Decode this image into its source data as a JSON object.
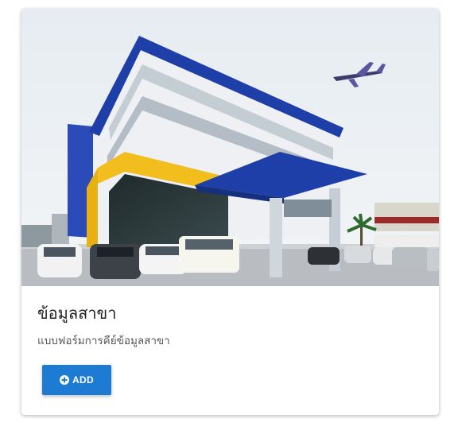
{
  "card": {
    "title": "ข้อมูลสาขา",
    "subtitle": "แบบฟอร์มการคีย์ข้อมูลสาขา",
    "add_button_label": "ADD",
    "add_button_icon": "plus-circle-icon",
    "image_subject": "branch-office-building-photo"
  },
  "colors": {
    "button": "#1e7bd4",
    "facade_blue": "#1f3fa8",
    "facade_yellow": "#f2be1d"
  }
}
